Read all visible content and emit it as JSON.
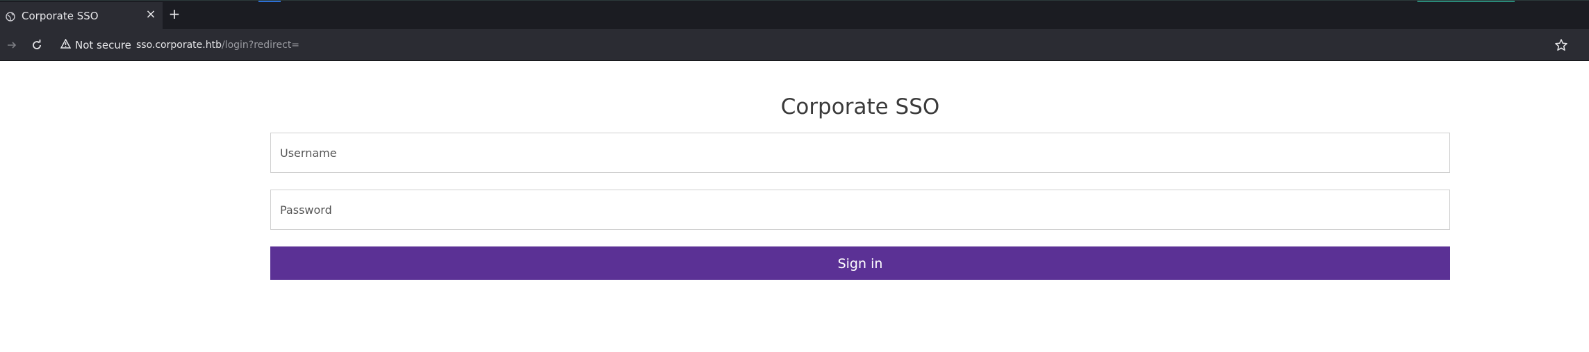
{
  "browser": {
    "tab": {
      "title": "Corporate SSO",
      "favicon": "globe-icon"
    },
    "new_tab_icon": "plus-icon",
    "close_tab_icon": "close-icon",
    "nav": {
      "forward_icon": "arrow-right-icon",
      "reload_icon": "reload-icon"
    },
    "security": {
      "icon": "warning-triangle-icon",
      "label": "Not secure"
    },
    "url": {
      "host": "sso.corporate.htb",
      "path": "/login?redirect="
    },
    "bookmark_icon": "star-icon"
  },
  "login": {
    "title": "Corporate SSO",
    "username_placeholder": "Username",
    "username_value": "",
    "password_placeholder": "Password",
    "password_value": "",
    "submit_label": "Sign in"
  },
  "colors": {
    "tabbar_bg": "#1b1c22",
    "toolbar_bg": "#2b2c33",
    "button_bg": "#5b3195",
    "button_text": "#ffffff",
    "heading_text": "#3a3a3a"
  }
}
